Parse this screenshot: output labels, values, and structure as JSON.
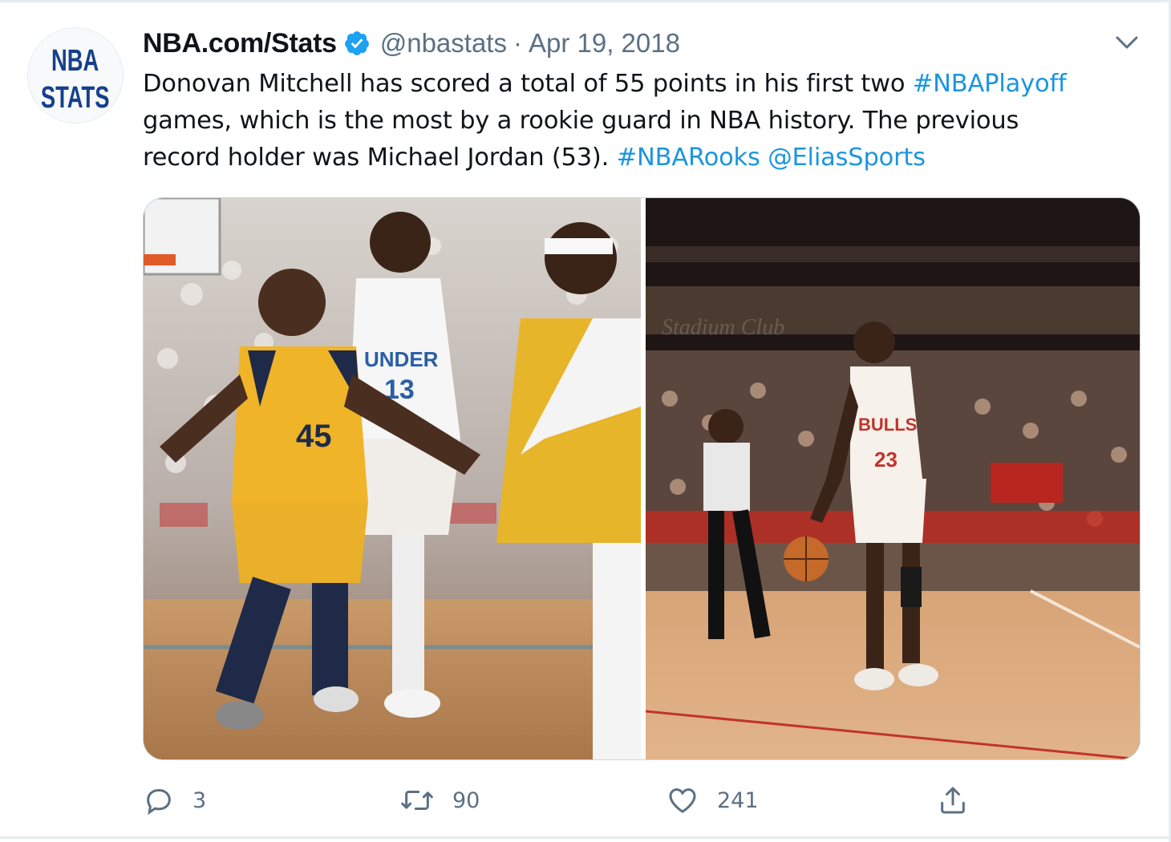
{
  "account": {
    "avatar_text_line1": "NBA",
    "avatar_text_line2": "STATS",
    "display_name": "NBA.com/Stats",
    "verified": true,
    "handle": "@nbastats",
    "separator": "·",
    "date": "Apr 19, 2018"
  },
  "tweet": {
    "line1_text": "Donovan Mitchell has scored a total of 55 points in his first two ",
    "line1_hashtag": "#NBAPlayoff",
    "line2_text": "games, which is the most by a rookie guard in NBA history. The previous",
    "line3_text": "record holder was Michael Jordan (53). ",
    "line3_hashtag": "#NBARooks",
    "line3_mention": "@EliasSports"
  },
  "media": {
    "left_photo": {
      "jersey_text": "UNDER",
      "jersey_number_white": "13",
      "jersey_number_yellow": "45"
    },
    "right_photo": {
      "arena_sign": "Stadium Club",
      "jersey_text": "BULLS",
      "jersey_number": "23"
    }
  },
  "actions": {
    "reply_count": "3",
    "retweet_count": "90",
    "like_count": "241"
  },
  "icons": {
    "reply": "reply-icon",
    "retweet": "retweet-icon",
    "like": "heart-icon",
    "share": "share-icon",
    "verified": "verified-badge-icon",
    "caret": "chevron-down-icon"
  },
  "colors": {
    "link": "#1b95e0",
    "verified": "#1da1f2",
    "secondary_text": "#5b7083",
    "brand_navy": "#17408b"
  }
}
